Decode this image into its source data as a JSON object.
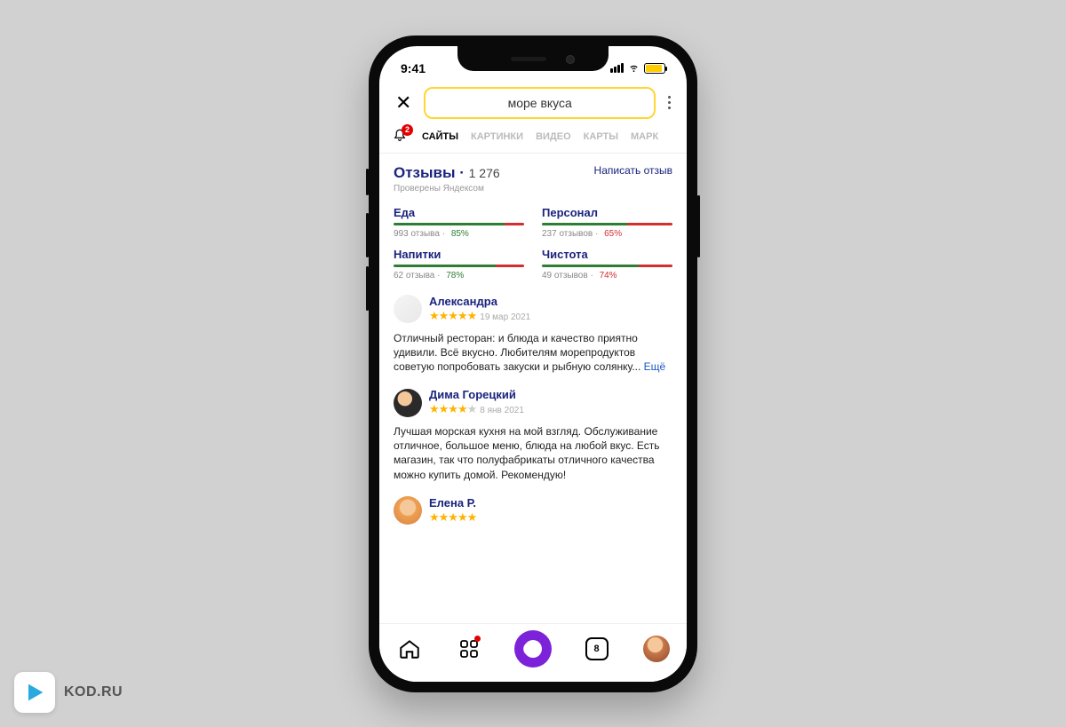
{
  "status": {
    "time": "9:41"
  },
  "search": {
    "value": "море вкуса"
  },
  "bell_badge": "2",
  "tabs": [
    "САЙТЫ",
    "КАРТИНКИ",
    "ВИДЕО",
    "КАРТЫ",
    "МАРК"
  ],
  "reviews": {
    "title": "Отзывы",
    "count": "1 276",
    "verified": "Проверены Яндексом",
    "write": "Написать отзыв"
  },
  "categories": [
    {
      "name": "Еда",
      "meta": "993 отзыва",
      "pct": "85%",
      "green": 85,
      "pctClass": "green"
    },
    {
      "name": "Персонал",
      "meta": "237 отзывов",
      "pct": "65%",
      "green": 65,
      "pctClass": "red"
    },
    {
      "name": "Напитки",
      "meta": "62 отзыва",
      "pct": "78%",
      "green": 78,
      "pctClass": "green"
    },
    {
      "name": "Чистота",
      "meta": "49 отзывов",
      "pct": "74%",
      "green": 74,
      "pctClass": "red"
    }
  ],
  "items": [
    {
      "name": "Александра",
      "stars": 5,
      "date": "19 мар 2021",
      "text": "Отличный ресторан: и блюда и качество приятно удивили. Всё вкусно. Любителям морепродуктов советую попробовать закуски и рыбную солянку... ",
      "more": "Ещё"
    },
    {
      "name": "Дима Горецкий",
      "stars": 4,
      "date": "8 янв 2021",
      "text": "Лучшая морская кухня на мой взгляд. Обслуживание отличное, большое меню, блюда на любой вкус. Есть магазин, так что полуфабрикаты отличного качества можно купить домой. Рекомендую!"
    },
    {
      "name": "Елена Р.",
      "stars": 5,
      "date": ""
    }
  ],
  "bottomnav": {
    "tabs_count": "8"
  },
  "watermark": "KOD.RU"
}
